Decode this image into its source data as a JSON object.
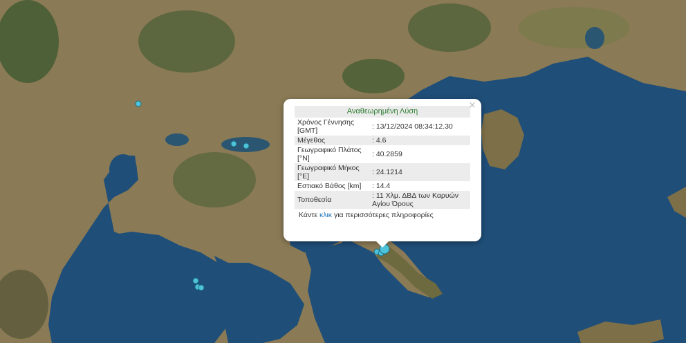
{
  "colors": {
    "sea": "#1f4e78",
    "sea_deep": "#173f66",
    "land": "#8a7a55",
    "forest": "#3f5a30",
    "lake": "#2a5672",
    "marker_fill": "#4fc3d9",
    "marker_stroke": "#1a6f85",
    "title_green": "#2e7d32",
    "link_blue": "#1a73b8"
  },
  "markers": {
    "m1": "earthquake-marker",
    "icon_name": "circle-marker"
  },
  "popup": {
    "close_symbol": "×",
    "title": "Αναθεωρημένη Λύση",
    "rows": [
      {
        "label": "Χρόνος Γέννησης [GMT]",
        "value": ": 13/12/2024 08:34:12.30"
      },
      {
        "label": "Μέγεθος",
        "value": ": 4.6"
      },
      {
        "label": "Γεωγραφικό Πλάτος [°N]",
        "value": ": 40.2859"
      },
      {
        "label": "Γεωγραφικό Μήκος [°E]",
        "value": ": 24.1214"
      },
      {
        "label": "Εστιακό Βάθος [km]",
        "value": ": 14.4"
      },
      {
        "label": "Τοποθεσία",
        "value": ": 11 Χλμ. ΔΒΔ των Καρυών Αγίου Όρους"
      }
    ],
    "more_prefix": "Κάντε ",
    "more_link": "κλικ",
    "more_suffix": " για περισσότερες πληροφορίες"
  }
}
